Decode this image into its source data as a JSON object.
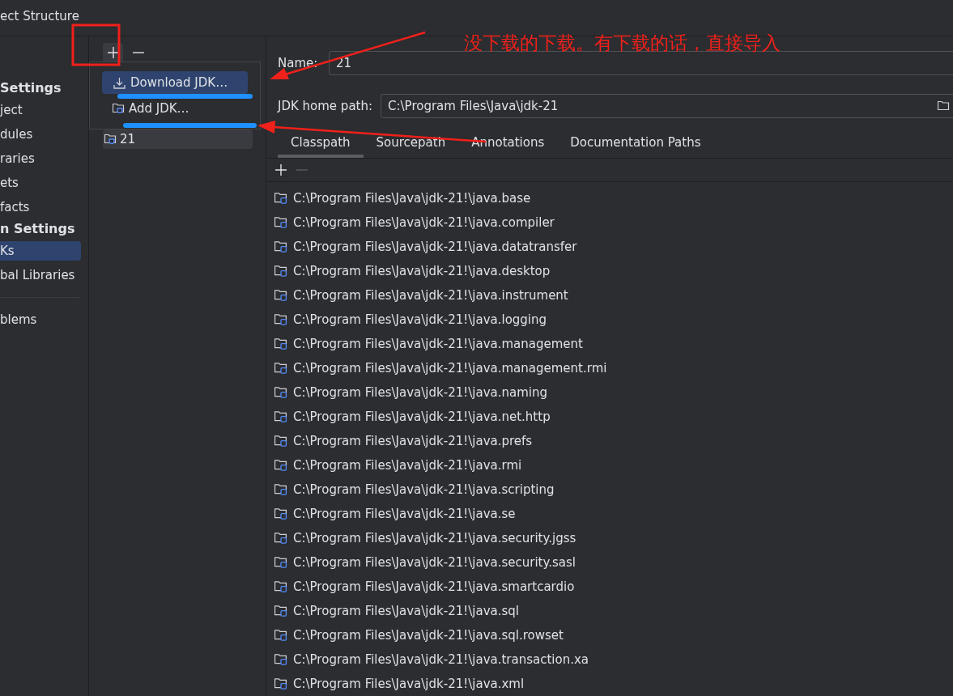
{
  "window": {
    "title": "ect Structure"
  },
  "sidebar": {
    "sections": [
      {
        "header": "Settings",
        "items": [
          {
            "label": "ject",
            "selected": false
          },
          {
            "label": "dules",
            "selected": false
          },
          {
            "label": "raries",
            "selected": false
          },
          {
            "label": "ets",
            "selected": false
          },
          {
            "label": "facts",
            "selected": false
          }
        ]
      },
      {
        "header": "n Settings",
        "items": [
          {
            "label": "Ks",
            "selected": true
          },
          {
            "label": "bal Libraries",
            "selected": false
          }
        ]
      }
    ],
    "footer_items": [
      {
        "label": "blems",
        "selected": false
      }
    ]
  },
  "sdk_list": {
    "items": [
      {
        "label": "21",
        "selected": true
      }
    ]
  },
  "add_menu": {
    "items": [
      {
        "label": "Download JDK…",
        "kind": "download",
        "selected": true
      },
      {
        "label": "Add JDK…",
        "kind": "add",
        "selected": false
      }
    ]
  },
  "form": {
    "name_label": "Name:",
    "name_value": "21",
    "home_path_label": "JDK home path:",
    "home_path_value": "C:\\Program Files\\Java\\jdk-21"
  },
  "tabs": [
    {
      "label": "Classpath",
      "selected": true
    },
    {
      "label": "Sourcepath",
      "selected": false
    },
    {
      "label": "Annotations",
      "selected": false
    },
    {
      "label": "Documentation Paths",
      "selected": false
    }
  ],
  "classpath": {
    "rows": [
      "C:\\Program Files\\Java\\jdk-21!\\java.base",
      "C:\\Program Files\\Java\\jdk-21!\\java.compiler",
      "C:\\Program Files\\Java\\jdk-21!\\java.datatransfer",
      "C:\\Program Files\\Java\\jdk-21!\\java.desktop",
      "C:\\Program Files\\Java\\jdk-21!\\java.instrument",
      "C:\\Program Files\\Java\\jdk-21!\\java.logging",
      "C:\\Program Files\\Java\\jdk-21!\\java.management",
      "C:\\Program Files\\Java\\jdk-21!\\java.management.rmi",
      "C:\\Program Files\\Java\\jdk-21!\\java.naming",
      "C:\\Program Files\\Java\\jdk-21!\\java.net.http",
      "C:\\Program Files\\Java\\jdk-21!\\java.prefs",
      "C:\\Program Files\\Java\\jdk-21!\\java.rmi",
      "C:\\Program Files\\Java\\jdk-21!\\java.scripting",
      "C:\\Program Files\\Java\\jdk-21!\\java.se",
      "C:\\Program Files\\Java\\jdk-21!\\java.security.jgss",
      "C:\\Program Files\\Java\\jdk-21!\\java.security.sasl",
      "C:\\Program Files\\Java\\jdk-21!\\java.smartcardio",
      "C:\\Program Files\\Java\\jdk-21!\\java.sql",
      "C:\\Program Files\\Java\\jdk-21!\\java.sql.rowset",
      "C:\\Program Files\\Java\\jdk-21!\\java.transaction.xa",
      "C:\\Program Files\\Java\\jdk-21!\\java.xml"
    ]
  },
  "annotation": {
    "text": "没下载的下载。有下载的话，直接导入"
  }
}
